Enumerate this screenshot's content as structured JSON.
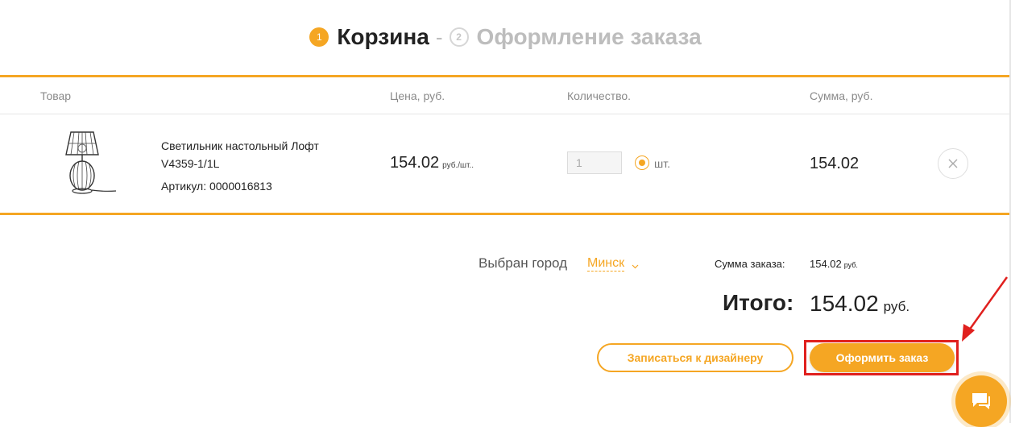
{
  "colors": {
    "accent": "#f5a623",
    "annotation": "#e0201e"
  },
  "steps": [
    {
      "number": "1",
      "label": "Корзина",
      "active": true
    },
    {
      "number": "2",
      "label": "Оформление заказа",
      "active": false
    }
  ],
  "steps_separator": "-",
  "table": {
    "headers": {
      "product": "Товар",
      "price": "Цена, руб.",
      "quantity": "Количество.",
      "sum": "Сумма, руб."
    },
    "item": {
      "image_icon": "table-lamp-icon",
      "name": "Светильник настольный Лофт V4359-1/1L",
      "sku": "Артикул: 0000016813",
      "price": "154.02",
      "price_unit": "руб./шт..",
      "quantity": "1",
      "unit": "шт.",
      "sum": "154.02",
      "remove_icon": "close-icon"
    }
  },
  "summary": {
    "city_label": "Выбран город",
    "city": "Минск",
    "order_sum_label": "Сумма заказа:",
    "order_sum": "154.02",
    "order_sum_unit": "руб.",
    "total_label": "Итого:",
    "total": "154.02",
    "total_unit": "руб."
  },
  "buttons": {
    "designer": "Записаться к дизайнеру",
    "order": "Оформить заказ"
  },
  "chat_icon": "chat-icon"
}
